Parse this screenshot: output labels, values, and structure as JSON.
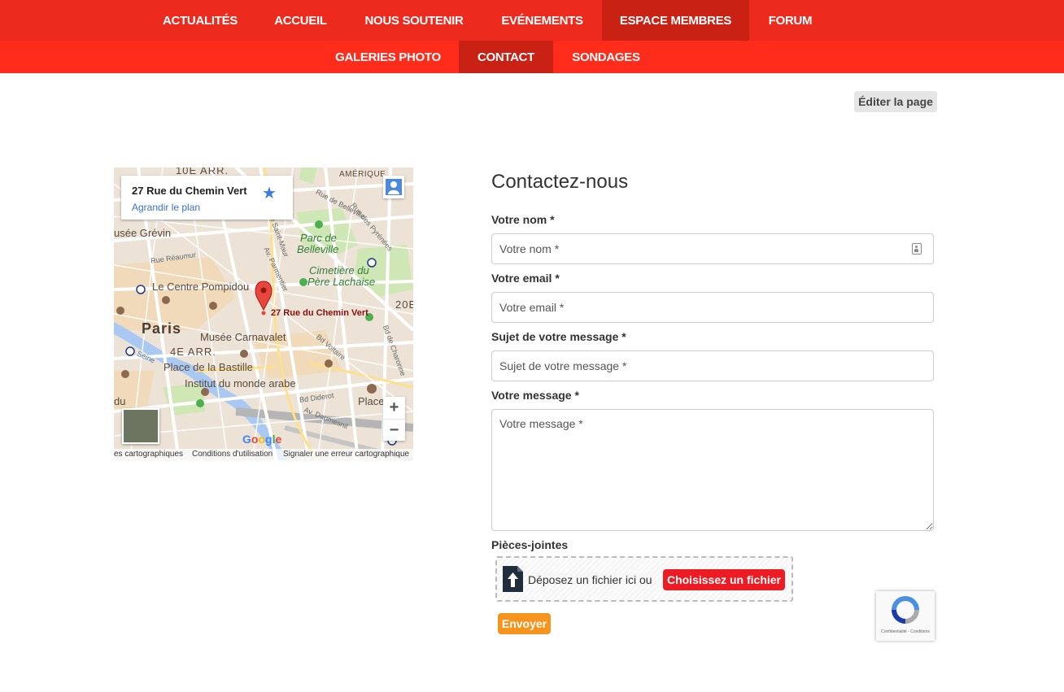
{
  "nav": {
    "primary": [
      {
        "label": "ACTUALITÉS",
        "active": false
      },
      {
        "label": "ACCUEIL",
        "active": false
      },
      {
        "label": "NOUS SOUTENIR",
        "active": false
      },
      {
        "label": "EVÉNEMENTS",
        "active": false
      },
      {
        "label": "ESPACE MEMBRES",
        "active": true
      },
      {
        "label": "FORUM",
        "active": false
      }
    ],
    "secondary": [
      {
        "label": "GALERIES PHOTO",
        "active": false
      },
      {
        "label": "CONTACT",
        "active": true
      },
      {
        "label": "SONDAGES",
        "active": false
      }
    ],
    "primary_color": "#ec2a1e",
    "secondary_color": "#ff2c1b",
    "active_color": "#c92215"
  },
  "edit_page_label": "Éditer la page",
  "map": {
    "address": "27 Rue du Chemin Vert",
    "enlarge_label": "Agrandir le plan",
    "pin_label": "27 Rue du Chemin Vert",
    "labels": {
      "arr10": "10E ARR.",
      "amerique": "AMÉRIQUE",
      "grevin": "usée Grévin",
      "parc": "Parc de",
      "belleville": "Belleville",
      "cimetiere": "Cimetière du",
      "lachaise": "Père Lachaise",
      "pompidou": "Le Centre Pompidou",
      "paris": "Paris",
      "carnavalet": "Musée Carnavalet",
      "arr4": "4E ARR.",
      "bastille": "Place de la Bastille",
      "ima": "Institut du monde arabe",
      "arr20": "20E",
      "place": "Place",
      "bd_diderot": "Bd Diderot",
      "daumesnil": "Av. Daumesnil",
      "reaumur": "Rue Réaumur",
      "rue_belleville": "Rue de Belleville",
      "pyrenees": "Rue des Pyrénées",
      "saint_maur": "Rue Saint-Maur",
      "parmentier": "Av. Parmentier",
      "voltaire": "Bd Voltaire",
      "charonne": "Bd de Charonne",
      "seine": "Seine",
      "du": "du"
    },
    "footer": {
      "data": "es cartographiques",
      "terms": "Conditions d'utilisation",
      "report": "Signaler une erreur cartographique"
    },
    "google_logo": "Google",
    "zoom_in": "+",
    "zoom_out": "−"
  },
  "form": {
    "title": "Contactez-nous",
    "name_label": "Votre nom *",
    "name_placeholder": "Votre nom *",
    "email_label": "Votre email *",
    "email_placeholder": "Votre email *",
    "subject_label": "Sujet de votre message *",
    "subject_placeholder": "Sujet de votre message *",
    "message_label": "Votre message *",
    "message_placeholder": "Votre message *",
    "attachments_label": "Pièces-jointes",
    "drop_text": "Déposez un fichier ici ou",
    "choose_label": "Choisissez un fichier",
    "submit_label": "Envoyer"
  },
  "recaptcha": {
    "footer": "Confidentialité - Conditions"
  }
}
